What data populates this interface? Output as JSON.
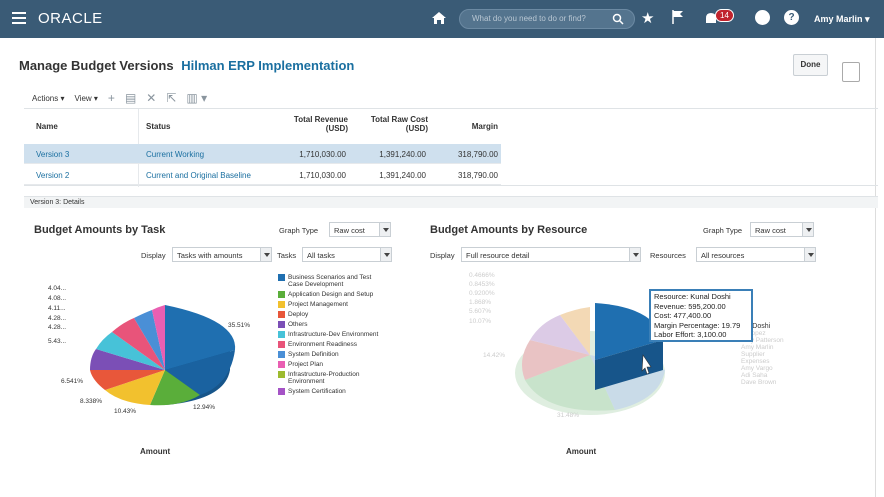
{
  "topbar": {
    "brand": "ORACLE",
    "search_placeholder": "What do you need to do or find?",
    "notification_count": "14",
    "user_name": "Amy Marlin ▾"
  },
  "page": {
    "title": "Manage Budget Versions",
    "project": "Hilman ERP Implementation",
    "done_label": "Done"
  },
  "toolbar": {
    "actions": "Actions ▾",
    "view": "View ▾"
  },
  "table": {
    "headers": {
      "name": "Name",
      "status": "Status",
      "revenue": "Total Revenue (USD)",
      "raw_cost": "Total Raw Cost (USD)",
      "margin": "Margin"
    },
    "rows": [
      {
        "name": "Version 3",
        "status": "Current Working",
        "revenue": "1,710,030.00",
        "raw_cost": "1,391,240.00",
        "margin": "318,790.00"
      },
      {
        "name": "Version 2",
        "status": "Current and Original Baseline",
        "revenue": "1,710,030.00",
        "raw_cost": "1,391,240.00",
        "margin": "318,790.00"
      }
    ]
  },
  "details": {
    "label": "Version 3: Details"
  },
  "task_chart": {
    "title": "Budget Amounts by Task",
    "graph_type_label": "Graph Type",
    "graph_type_value": "Raw cost",
    "display_label": "Display",
    "display_value": "Tasks with amounts",
    "tasks_label": "Tasks",
    "tasks_value": "All tasks",
    "axis_label": "Amount",
    "slice_labels": [
      "4.04...",
      "4.08...",
      "4.11...",
      "4.28...",
      "4.28...",
      "5.43...",
      "35.51%",
      "6.541%",
      "8.338%",
      "10.43%",
      "12.94%"
    ],
    "legend": [
      {
        "label": "Business Scenarios and Test Case Development",
        "color": "#1f6fb0"
      },
      {
        "label": "Application Design and Setup",
        "color": "#5aae3a"
      },
      {
        "label": "Project Management",
        "color": "#f2c12e"
      },
      {
        "label": "Deploy",
        "color": "#e8573a"
      },
      {
        "label": "Others",
        "color": "#7b4fb6"
      },
      {
        "label": "Infrastructure-Dev Environment",
        "color": "#47c2d8"
      },
      {
        "label": "Environment Readiness",
        "color": "#e8547a"
      },
      {
        "label": "System Definition",
        "color": "#4a8fd6"
      },
      {
        "label": "Project Plan",
        "color": "#e95fb2"
      },
      {
        "label": "Infrastructure-Production Environment",
        "color": "#9dbb2f"
      },
      {
        "label": "System Certification",
        "color": "#a553c6"
      }
    ]
  },
  "resource_chart": {
    "title": "Budget Amounts by Resource",
    "graph_type_label": "Graph Type",
    "graph_type_value": "Raw cost",
    "display_label": "Display",
    "display_value": "Full resource detail",
    "resources_label": "Resources",
    "resources_value": "All resources",
    "axis_label": "Amount",
    "faded_labels": [
      "0.4666%",
      "0.8453%",
      "0.9200%",
      "1.868%",
      "5.607%",
      "10.07%",
      "14.42%",
      "31.48%"
    ],
    "legend_partial": [
      "nal Doshi",
      "lo Lopez",
      "Amy Patterson",
      "Amy Marlin",
      "Supplier",
      "Expenses",
      "Amy Vargo",
      "Adi Saha",
      "Dave Brown"
    ],
    "tooltip": {
      "resource": "Resource: Kunal Doshi",
      "revenue": "Revenue: 595,200.00",
      "cost": "Cost: 477,400.00",
      "margin_pct": "Margin Percentage: 19.79",
      "labor_effort": "Labor Effort: 3,100.00"
    }
  }
}
